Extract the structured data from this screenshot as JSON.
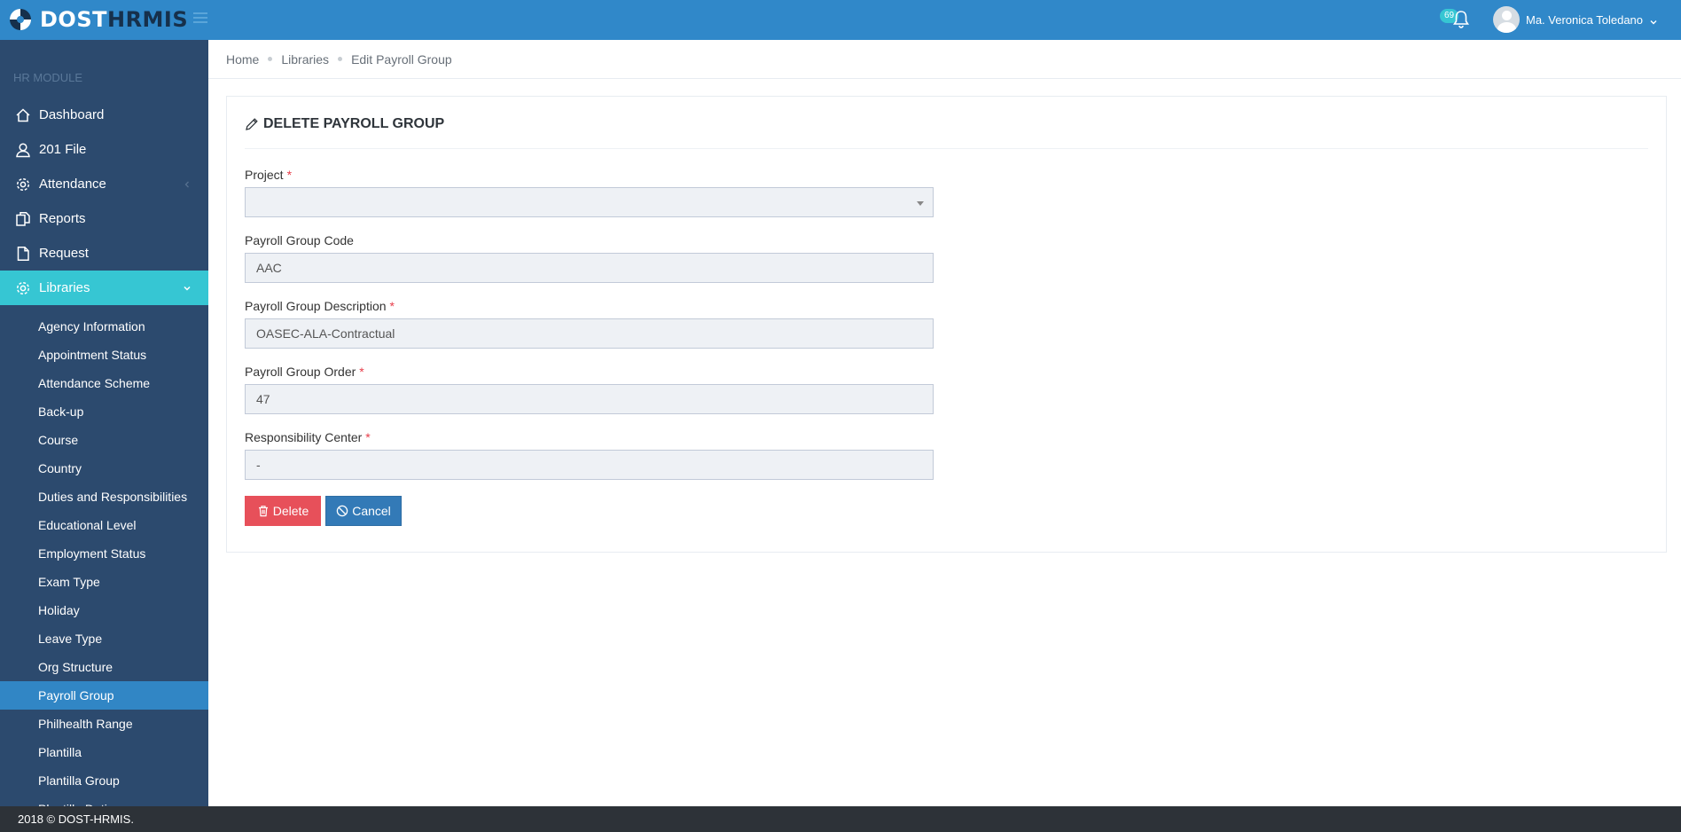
{
  "header": {
    "logo_part1": "DOST",
    "logo_part2": "HRMIS",
    "notification_count": "69",
    "user_name": "Ma. Veronica Toledano"
  },
  "sidebar": {
    "heading": "HR MODULE",
    "items": [
      {
        "label": "Dashboard",
        "icon": "home-icon"
      },
      {
        "label": "201 File",
        "icon": "user-icon"
      },
      {
        "label": "Attendance",
        "icon": "gear-icon"
      },
      {
        "label": "Reports",
        "icon": "copy-icon"
      },
      {
        "label": "Request",
        "icon": "file-icon"
      },
      {
        "label": "Libraries",
        "icon": "gear-icon",
        "active": true
      }
    ],
    "sub_items": [
      "Agency Information",
      "Appointment Status",
      "Attendance Scheme",
      "Back-up",
      "Course",
      "Country",
      "Duties and Responsibilities",
      "Educational Level",
      "Employment Status",
      "Exam Type",
      "Holiday",
      "Leave Type",
      "Org Structure",
      "Payroll Group",
      "Philhealth Range",
      "Plantilla",
      "Plantilla Group",
      "Plantilla Duties"
    ],
    "active_sub_item": "Payroll Group"
  },
  "breadcrumb": [
    "Home",
    "Libraries",
    "Edit Payroll Group"
  ],
  "form": {
    "title": "DELETE PAYROLL GROUP",
    "project_label": "Project",
    "project_value": "",
    "code_label": "Payroll Group Code",
    "code_value": "AAC",
    "description_label": "Payroll Group Description",
    "description_value": "OASEC-ALA-Contractual",
    "order_label": "Payroll Group Order",
    "order_value": "47",
    "responsibility_label": "Responsibility Center",
    "responsibility_value": "-",
    "delete_label": "Delete",
    "cancel_label": "Cancel"
  },
  "footer": {
    "text": "2018 © DOST-HRMIS."
  },
  "colors": {
    "header": "#3088c9",
    "sidebar": "#2c4a6e",
    "active_nav": "#36c6d3",
    "active_sub": "#3186c5",
    "delete": "#e7505a",
    "cancel": "#337ab7"
  }
}
